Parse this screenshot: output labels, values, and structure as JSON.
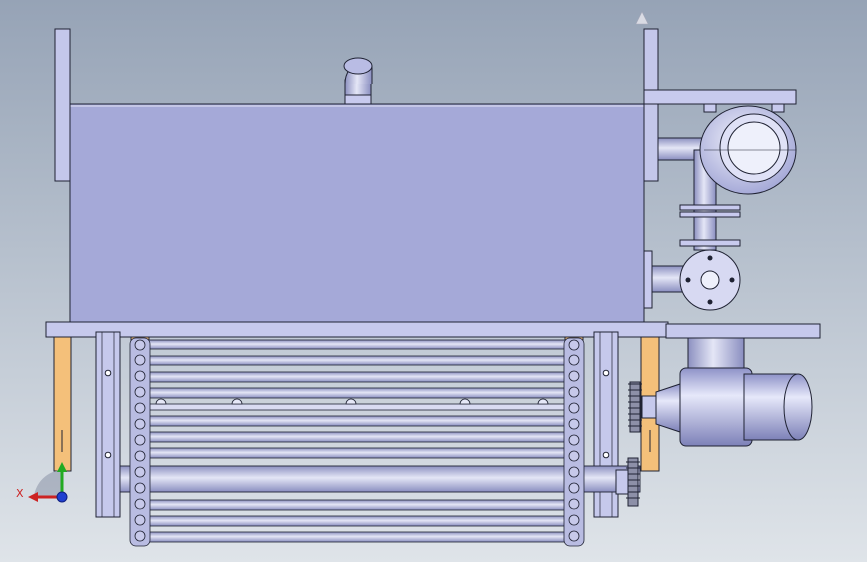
{
  "view": {
    "background_top": "#96a3b6",
    "background_bottom": "#dfe4e9",
    "body_color": "#a5a9d8",
    "steel_color": "#c9cbe8",
    "tan_color": "#f4c07a",
    "outline_color": "#1f2233"
  },
  "triad": {
    "x_label": "X",
    "x_color": "#cc2222",
    "y_color": "#22aa22",
    "z_color": "#1f3fd0"
  }
}
